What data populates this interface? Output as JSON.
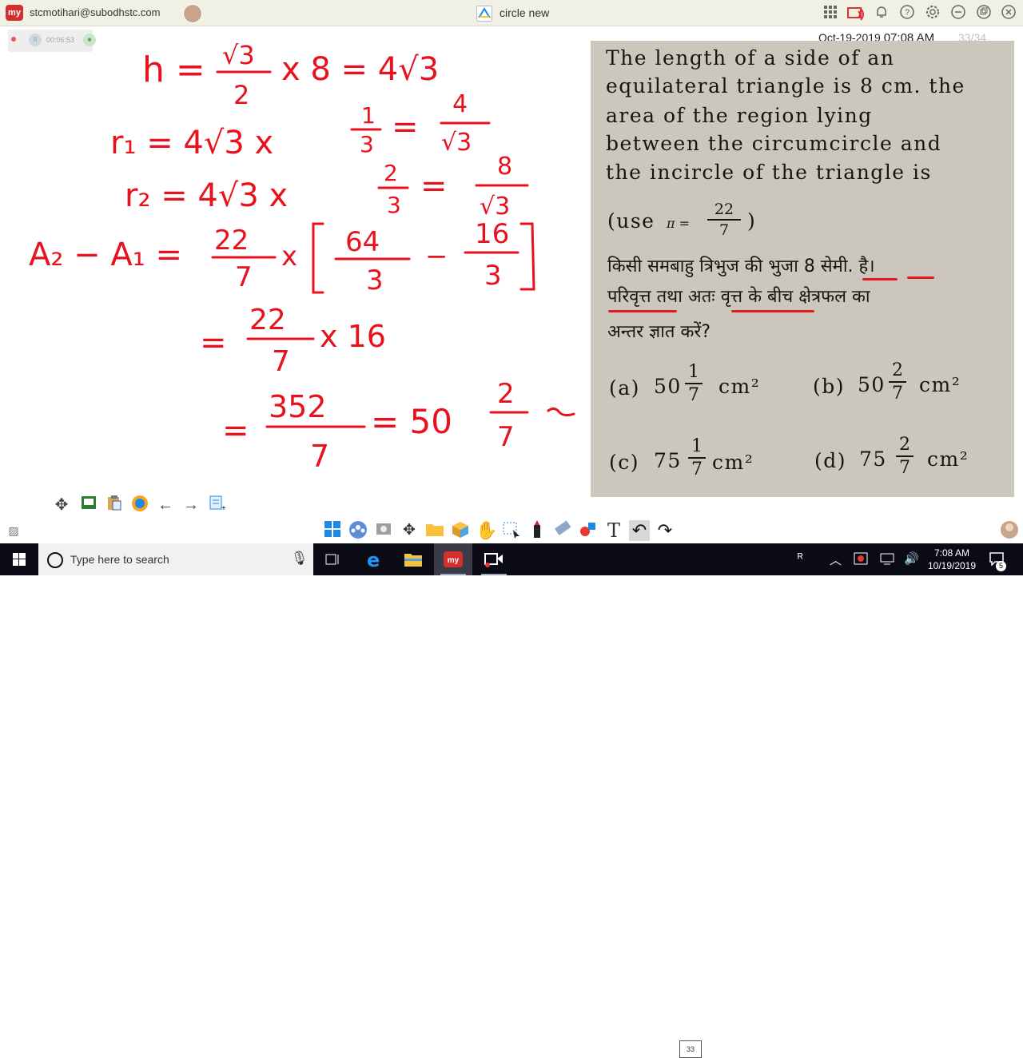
{
  "titlebar": {
    "app_logo": "my",
    "account": "stcmotihari@subodhstc.com",
    "document_title": "circle new",
    "icons": [
      "grid-icon",
      "cast-icon",
      "bell-icon",
      "help-icon",
      "settings-icon",
      "minimize-icon",
      "restore-icon",
      "close-icon"
    ]
  },
  "recording": {
    "timer": "00:06:53"
  },
  "handwriting": {
    "line1": [
      "h =",
      "√3",
      "2",
      "x 8 = 4√3"
    ],
    "line2": [
      "r₁ = 4√3 x",
      "1",
      "3",
      "=",
      "4",
      "√3"
    ],
    "line3": [
      "r₂ = 4√3 x",
      "2",
      "3",
      "=",
      "8",
      "√3"
    ],
    "line4": [
      "A₂ − A₁ =",
      "22",
      "7",
      "x",
      "64",
      "3",
      "−",
      "16",
      "3"
    ],
    "line5": [
      "=",
      "22",
      "7",
      "x 16"
    ],
    "line6": [
      "=",
      "352",
      "7",
      "= 50",
      "2",
      "7"
    ]
  },
  "header": {
    "date": "Oct-19-2019",
    "time": "07:08 AM",
    "page": "33/34"
  },
  "book": {
    "question_lines": [
      "The length of a side of an",
      "equilateral triangle is 8 cm. the",
      "area of the region lying",
      "between the circumcircle and",
      "the incircle of the triangle is"
    ],
    "use_label": "(use",
    "pi": "π =",
    "pi_num": "22",
    "pi_den": "7",
    "use_close": ")",
    "hindi_lines": [
      "किसी समबाहु त्रिभुज की भुजा 8 सेमी. है।",
      "परिवृत्त तथा अतः वृत्त के बीच क्षेत्रफल का",
      "अन्तर ज्ञात करें?"
    ],
    "options": [
      {
        "label": "(a)",
        "whole": "50",
        "num": "1",
        "den": "7",
        "unit": "cm²"
      },
      {
        "label": "(b)",
        "whole": "50",
        "num": "2",
        "den": "7",
        "unit": "cm²"
      },
      {
        "label": "(c)",
        "whole": "75",
        "num": "1",
        "den": "7",
        "unit": "cm²"
      },
      {
        "label": "(d)",
        "whole": "75",
        "num": "2",
        "den": "7",
        "unit": "cm²"
      }
    ]
  },
  "bottom_toolbar": {
    "page_badge": "33"
  },
  "taskbar": {
    "search_placeholder": "Type here to search",
    "clock_time": "7:08 AM",
    "clock_date": "10/19/2019",
    "notification_count": "5"
  },
  "colors": {
    "ink": "#e8121e",
    "taskbar": "#0b0b16",
    "titlebar": "#f1f0e4"
  }
}
